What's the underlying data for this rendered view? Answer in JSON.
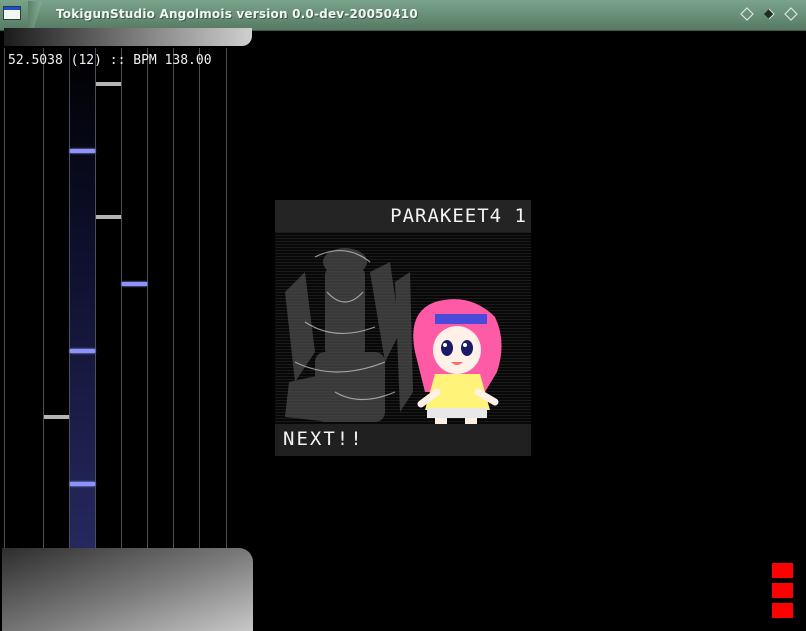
{
  "window": {
    "title": "TokigunStudio Angolmois version 0.0-dev-20050410"
  },
  "status": {
    "position": "52.5038",
    "measure": "(12)",
    "separator": "::",
    "bpm_label": "BPM",
    "bpm_value": "138.00"
  },
  "next_card": {
    "title": "PARAKEET4 1",
    "next_label": "NEXT!!"
  },
  "colors": {
    "titlebar": "#6f9980",
    "note_blue": "#8d92ff",
    "note_white": "#b5b5b5",
    "indicator": "#ff0000",
    "background": "#000000"
  },
  "indicators": {
    "count": 3
  }
}
